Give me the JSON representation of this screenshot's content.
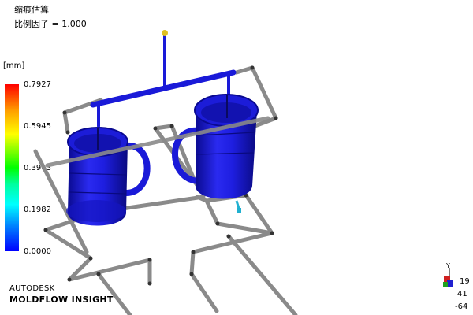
{
  "result": {
    "title": "缩痕估算",
    "scale_factor": "比例因子 = 1.000"
  },
  "legend": {
    "unit": "[mm]",
    "ticks": [
      "0.7927",
      "0.5945",
      "0.3963",
      "0.1982",
      "0.0000"
    ],
    "colors": {
      "max": "#ff0000",
      "min": "#0000ff"
    }
  },
  "branding": {
    "line1": "AUTODESK",
    "line2": "MOLDFLOW INSIGHT"
  },
  "axis_triad": {
    "labels": [
      "19",
      "41",
      "-64"
    ],
    "axis_mark": "Y"
  },
  "colors": {
    "part": "#1a1ad8",
    "cooling_channel": "#8a8a8a",
    "injection_point": "#e0c020",
    "hotspot": "#20b0d0"
  }
}
